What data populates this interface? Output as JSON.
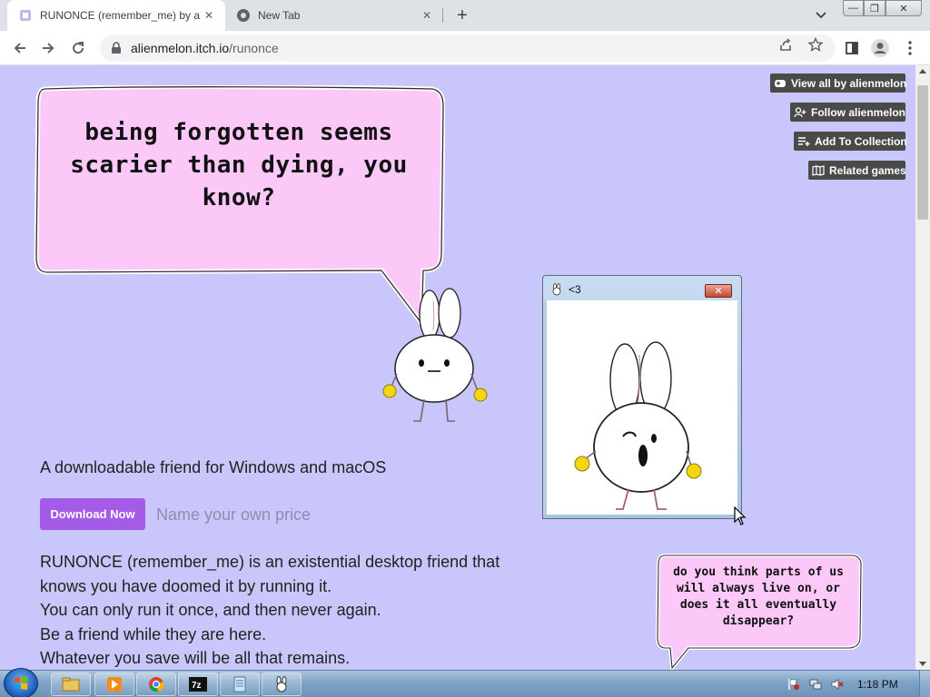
{
  "browser": {
    "tabs": [
      {
        "title": "RUNONCE (remember_me) by al",
        "close": "✕"
      },
      {
        "title": "New Tab",
        "close": "✕"
      }
    ],
    "new_tab": "+",
    "window_controls": {
      "minimize": "—",
      "maximize": "❐",
      "close": "✕"
    },
    "url_host": "alienmelon.itch.io",
    "url_path": "/runonce"
  },
  "page": {
    "background": "#c8c6fb",
    "side_buttons": {
      "view_all": "View all by alienmelon",
      "follow": "Follow alienmelon",
      "collection": "Add To Collection",
      "related": "Related games"
    },
    "speech_main": "being forgotten seems scarier than dying, you know?",
    "tagline": "A downloadable friend for Windows and macOS",
    "download_button": "Download Now",
    "price_placeholder": "Name your own price",
    "description": [
      "RUNONCE (remember_me) is an existential desktop friend that",
      "knows you have doomed it by running it.",
      "You can only run it once, and then never again.",
      "Be a friend while they are here.",
      "Whatever you save will be all that remains."
    ],
    "popup_window": {
      "title": "<3"
    },
    "speech_small": "do you think parts of us will always live on, or does it all eventually disappear?"
  },
  "taskbar": {
    "clock": "1:18 PM",
    "items": [
      "explorer-icon",
      "media-player-icon",
      "chrome-icon",
      "7zip-icon",
      "notepad-icon",
      "bunny-app-icon"
    ]
  },
  "colors": {
    "accent": "#a45be8",
    "page_bg": "#c8c6fb",
    "speech_bg": "#fbc8f8",
    "bunny_paw": "#f5d410"
  }
}
